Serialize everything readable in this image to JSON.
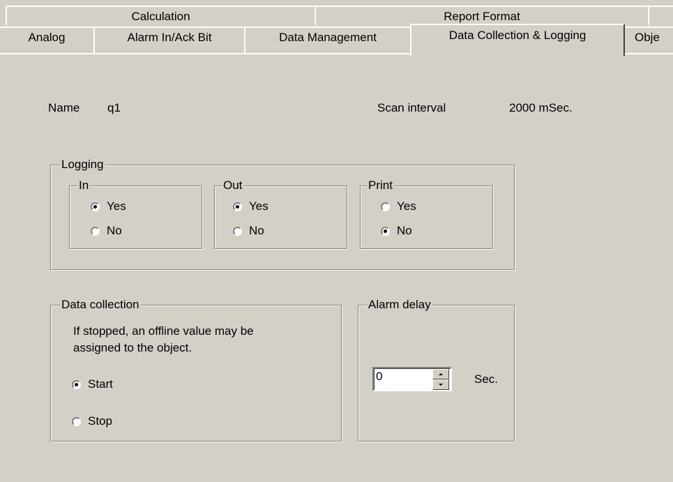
{
  "tabs": {
    "row_back": [
      "Calculation",
      "Report Format"
    ],
    "row_front": [
      "Analog",
      "Alarm In/Ack Bit",
      "Data Management",
      "Data Collection & Logging",
      "Obje"
    ],
    "selected": "Data Collection & Logging"
  },
  "object": {
    "name_label": "Name",
    "name_value": "q1",
    "scan_label": "Scan interval",
    "scan_value": "2000 mSec."
  },
  "logging": {
    "title": "Logging",
    "groups": [
      {
        "title": "In",
        "yes_label": "Yes",
        "no_label": "No",
        "selected": "Yes"
      },
      {
        "title": "Out",
        "yes_label": "Yes",
        "no_label": "No",
        "selected": "Yes"
      },
      {
        "title": "Print",
        "yes_label": "Yes",
        "no_label": "No",
        "selected": "No"
      }
    ]
  },
  "data_collection": {
    "title": "Data collection",
    "note_line1": "If stopped, an offline value may be",
    "note_line2": "assigned to the object.",
    "start_label": "Start",
    "stop_label": "Stop",
    "selected": "Start"
  },
  "alarm_delay": {
    "title": "Alarm delay",
    "value": "0",
    "unit": "Sec."
  }
}
